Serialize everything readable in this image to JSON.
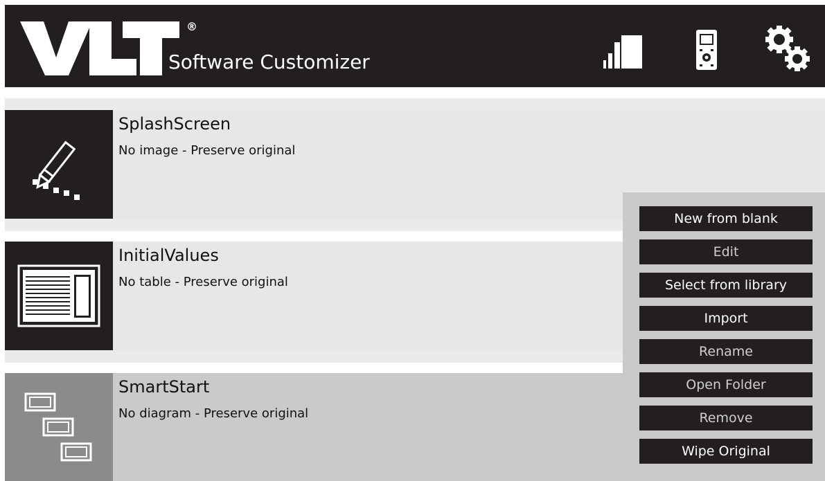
{
  "header": {
    "logo_text": "VLT",
    "registered_mark": "®",
    "subtitle": "Software Customizer",
    "icons": [
      "bar-chart-icon",
      "lcp-device-icon",
      "settings-gears-icon"
    ]
  },
  "rows": [
    {
      "title": "SplashScreen",
      "status": "No image - Preserve original",
      "icon": "pencil-icon"
    },
    {
      "title": "InitialValues",
      "status": "No table - Preserve original",
      "icon": "table-icon"
    },
    {
      "title": "SmartStart",
      "status": "No diagram - Preserve original",
      "icon": "diagram-icon"
    }
  ],
  "actions": {
    "new_from_blank": "New from blank",
    "edit": "Edit",
    "select_from_library": "Select from library",
    "import": "Import",
    "rename": "Rename",
    "open_folder": "Open Folder",
    "remove": "Remove",
    "wipe_original": "Wipe Original"
  },
  "colors": {
    "header_bg": "#231f20",
    "row_bg": "#e6e7e8",
    "row_selected_bg": "#c9cacb",
    "thumb_selected_bg": "#8a8b8c",
    "button_bg": "#231f20"
  }
}
